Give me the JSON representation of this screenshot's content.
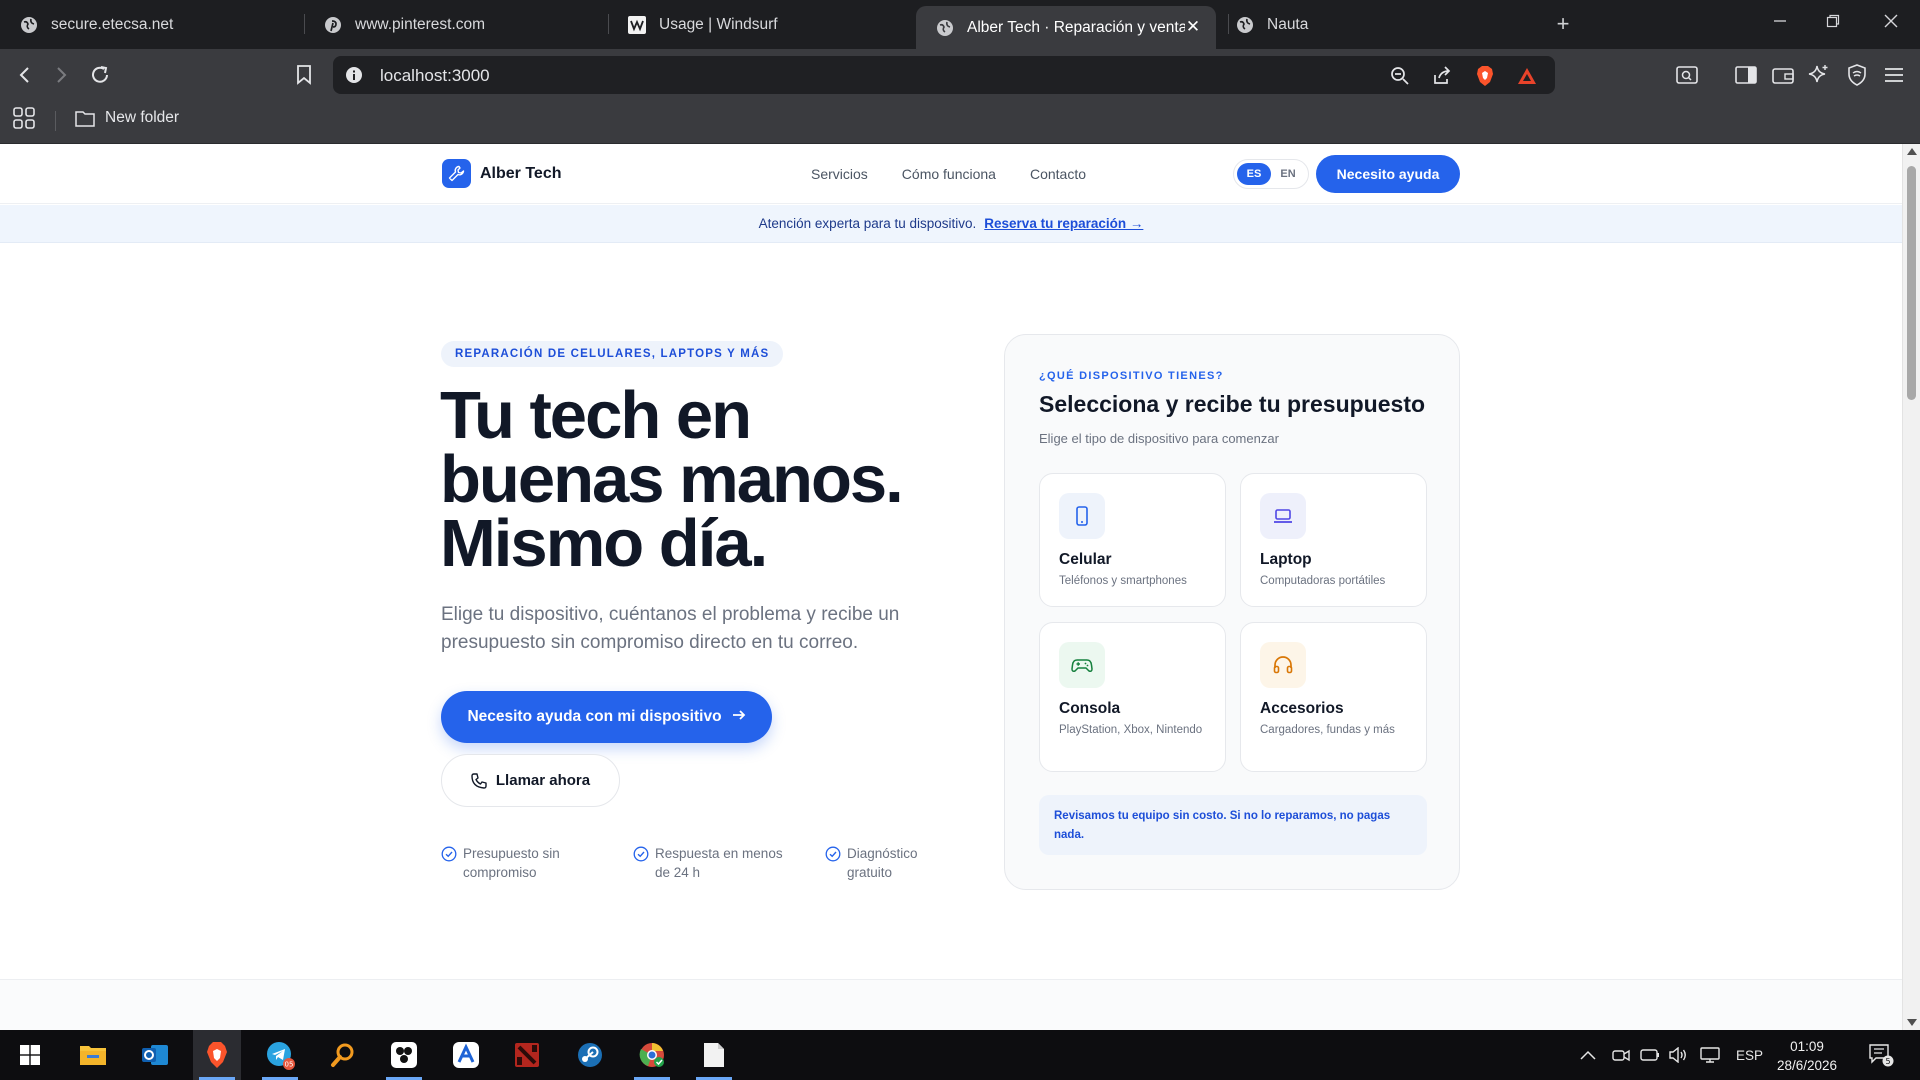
{
  "browser": {
    "tabs": [
      {
        "label": "secure.etecsa.net",
        "icon": "globe-icon"
      },
      {
        "label": "www.pinterest.com",
        "icon": "pinterest-icon"
      },
      {
        "label": "Usage | Windsurf",
        "icon": "windsurf-icon"
      },
      {
        "label": "Alber Tech · Reparación y venta d",
        "icon": "globe-icon",
        "active": true
      },
      {
        "label": "Nauta",
        "icon": "globe-icon"
      }
    ],
    "url": "localhost:3000",
    "bookmark_folder": "New folder"
  },
  "site": {
    "brand": "Alber Tech",
    "nav": [
      "Servicios",
      "Cómo funciona",
      "Contacto"
    ],
    "lang": {
      "active": "ES",
      "other": "EN"
    },
    "nav_cta": "Necesito ayuda",
    "announce": {
      "text": "Atención experta para tu dispositivo.",
      "link": "Reserva tu reparación →"
    }
  },
  "hero": {
    "eyebrow": "REPARACIÓN DE CELULARES, LAPTOPS Y MÁS",
    "title_lines": [
      "Tu tech en",
      "buenas manos.",
      "Mismo día."
    ],
    "subtitle": "Elige tu dispositivo, cuéntanos el problema y recibe un presupuesto sin compromiso directo en tu correo.",
    "cta_primary": "Necesito ayuda con mi dispositivo",
    "cta_secondary": "Llamar ahora",
    "perks": [
      "Presupuesto sin compromiso",
      "Respuesta en menos de 24 h",
      "Diagnóstico gratuito"
    ]
  },
  "card": {
    "eyebrow": "¿QUÉ DISPOSITIVO TIENES?",
    "title": "Selecciona y recibe tu presupuesto",
    "subtitle": "Elige el tipo de dispositivo para comenzar",
    "devices": [
      {
        "name": "Celular",
        "desc": "Teléfonos y smartphones",
        "icon": "phone-icon",
        "color": "#2563eb",
        "bg": "#eef3fb"
      },
      {
        "name": "Laptop",
        "desc": "Computadoras portátiles",
        "icon": "laptop-icon",
        "color": "#4f46e5",
        "bg": "#eef0fb"
      },
      {
        "name": "Consola",
        "desc": "PlayStation, Xbox, Nintendo",
        "icon": "gamepad-icon",
        "color": "#15803d",
        "bg": "#ecf8f0"
      },
      {
        "name": "Accesorios",
        "desc": "Cargadores, fundas y más",
        "icon": "headphones-icon",
        "color": "#d97706",
        "bg": "#fdf5e8"
      }
    ],
    "guarantee": "Revisamos tu equipo sin costo. Si no lo reparamos, no pagas nada."
  },
  "taskbar": {
    "apps": [
      "windows-start-icon",
      "file-explorer-icon",
      "outlook-icon",
      "brave-icon",
      "telegram-icon",
      "search-app-icon",
      "davinci-icon",
      "arc-icon",
      "dota-icon",
      "steam-icon",
      "chrome-canary-icon",
      "notepad-icon"
    ],
    "telegram_badge": "05",
    "language": "ESP",
    "time": "01:09",
    "date": "28/6/2026",
    "notifications": "5"
  },
  "colors": {
    "accent": "#2563eb",
    "heading": "#111827",
    "muted": "#6b7280"
  }
}
